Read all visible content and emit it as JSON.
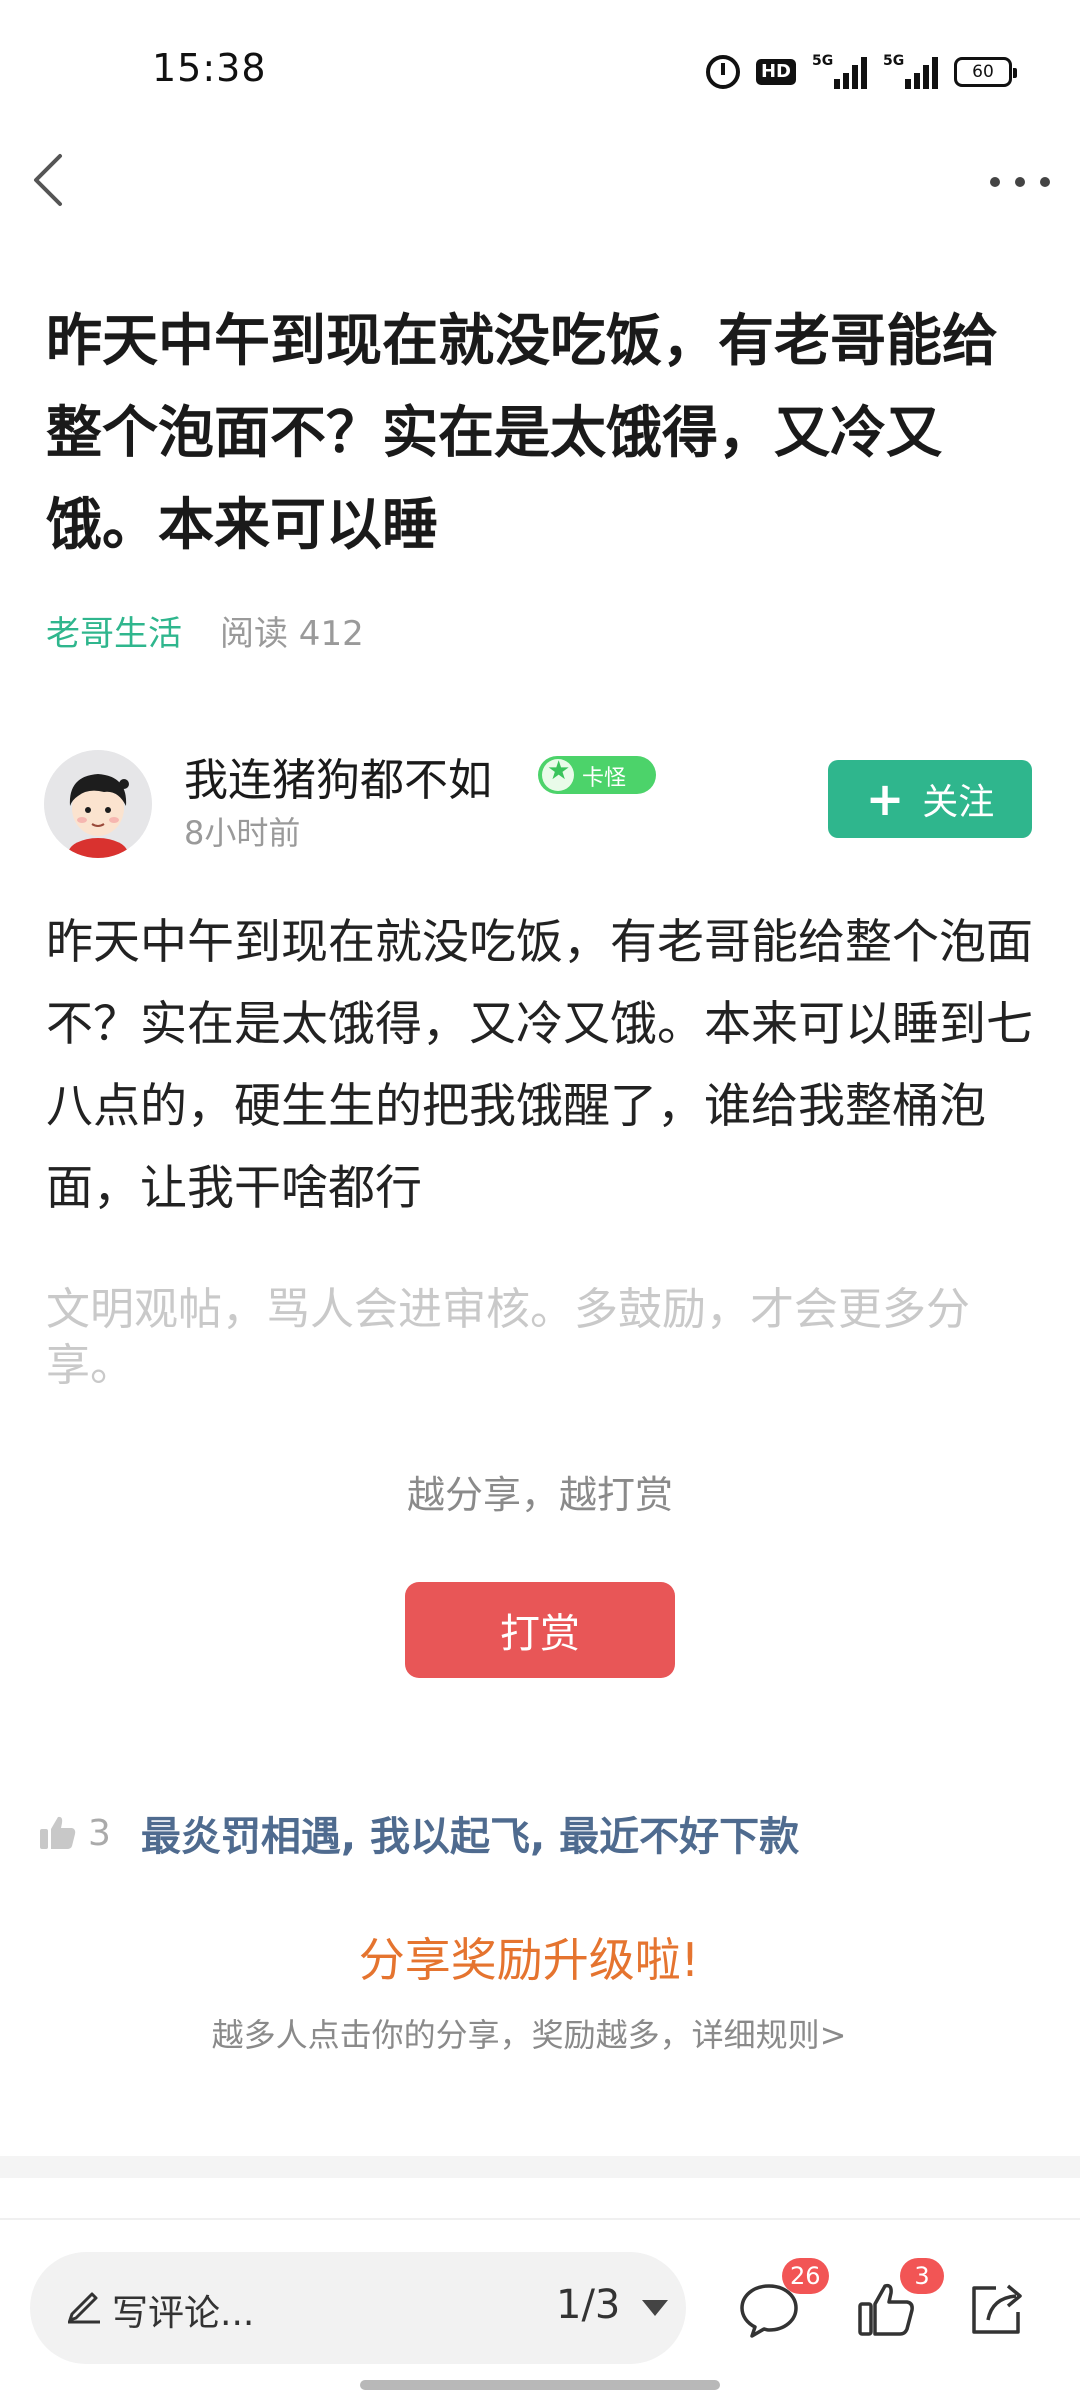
{
  "status_bar": {
    "time": "15:38",
    "hd_label": "HD",
    "signal1_label": "5G",
    "signal2_label": "5G",
    "battery": "60"
  },
  "nav": {
    "back_icon": "chevron-left-icon",
    "more_icon": "more-horizontal-icon"
  },
  "post": {
    "title": "昨天中午到现在就没吃饭，有老哥能给整个泡面不？实在是太饿得，又冷又饿。本来可以睡",
    "channel": "老哥生活",
    "reads": "阅读 412",
    "body": "昨天中午到现在就没吃饭，有老哥能给整个泡面不？实在是太饿得，又冷又饿。本来可以睡到七八点的，硬生生的把我饿醒了，谁给我整桶泡面，让我干啥都行",
    "civil_note": "文明观帖，骂人会进审核。多鼓励，才会更多分享。"
  },
  "author": {
    "name": "我连猪狗都不如",
    "badge": "卡怪",
    "time": "8小时前",
    "follow_label": "关注"
  },
  "reward": {
    "tip": "越分享，越打赏",
    "button": "打赏"
  },
  "likes": {
    "count": "3",
    "users": "最炎罚相遇, 我以起飞, 最近不好下款"
  },
  "promo": {
    "title": "分享奖励升级啦!",
    "subtitle": "越多人点击你的分享，奖励越多，详细规则>"
  },
  "bottom_bar": {
    "comment_placeholder": "写评论...",
    "page_indicator": "1/3",
    "comment_count": "26",
    "like_count": "3"
  },
  "colors": {
    "accent_green": "#2fb68d",
    "reward_red": "#e85657",
    "promo_orange": "#e5742f",
    "link_blue": "#4f6b8f"
  }
}
